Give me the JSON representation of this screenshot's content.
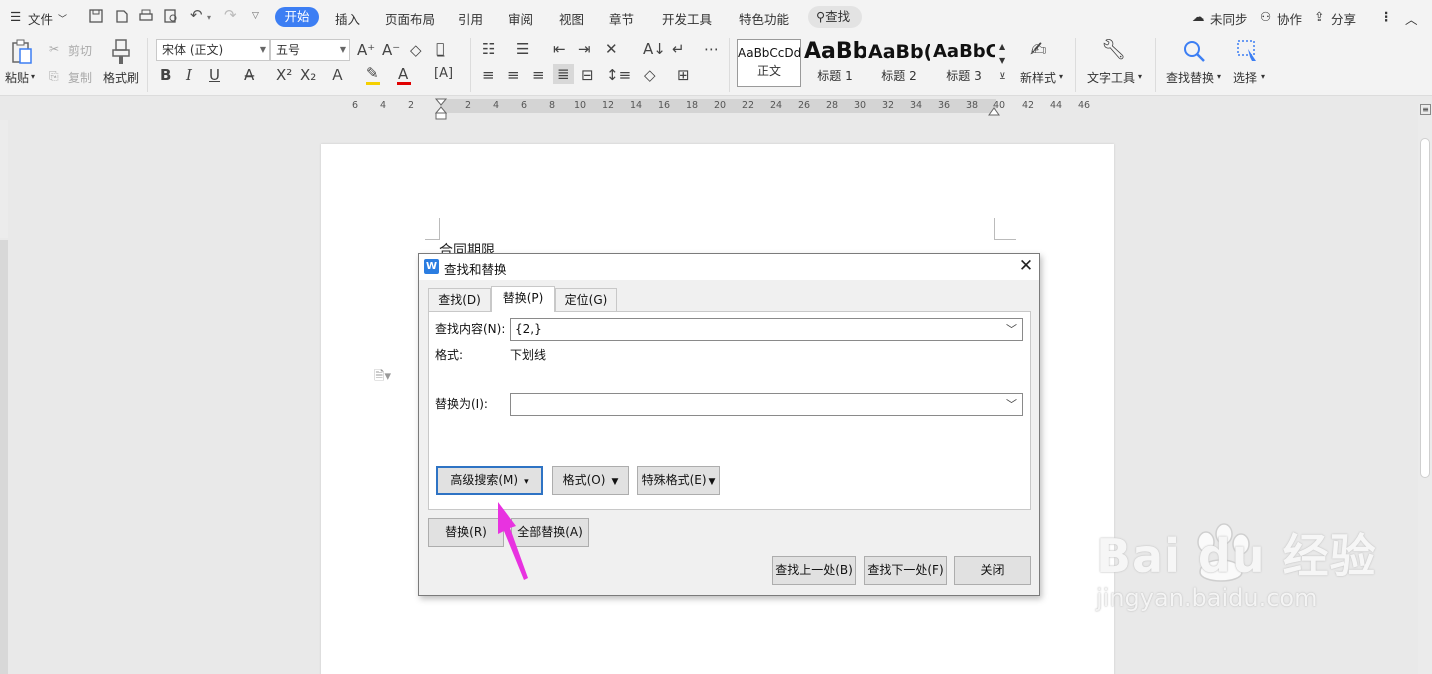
{
  "menubar": {
    "file": "文件",
    "tabs": [
      "开始",
      "插入",
      "页面布局",
      "引用",
      "审阅",
      "视图",
      "章节",
      "开发工具",
      "特色功能"
    ],
    "search": "查找",
    "sync": "未同步",
    "collab": "协作",
    "share": "分享"
  },
  "ribbon": {
    "paste": "粘贴",
    "cut": "剪切",
    "copy": "复制",
    "format_painter": "格式刷",
    "font_name": "宋体 (正文)",
    "font_size": "五号",
    "styles": [
      {
        "sample": "AaBbCcDd",
        "name": "正文"
      },
      {
        "sample": "AaBb",
        "name": "标题 1"
      },
      {
        "sample": "AaBb(",
        "name": "标题 2"
      },
      {
        "sample": "AaBbC",
        "name": "标题 3"
      }
    ],
    "new_style": "新样式",
    "text_tools": "文字工具",
    "find_replace": "查找替换",
    "select": "选择"
  },
  "ruler": {
    "ticks": [
      "6",
      "4",
      "2",
      "2",
      "4",
      "6",
      "8",
      "10",
      "12",
      "14",
      "16",
      "18",
      "20",
      "22",
      "24",
      "26",
      "28",
      "30",
      "32",
      "34",
      "36",
      "38",
      "40",
      "42",
      "44",
      "46"
    ]
  },
  "document": {
    "text": "合同期限"
  },
  "dialog": {
    "title": "查找和替换",
    "tabs": [
      "查找(D)",
      "替换(P)",
      "定位(G)"
    ],
    "active_tab": "替换(P)",
    "find_label": "查找内容(N):",
    "find_value": "{2,}",
    "format_label": "格式:",
    "format_value": "下划线",
    "replace_label": "替换为(I):",
    "replace_value": "",
    "advanced_button": "高级搜索(M)",
    "format_button": "格式(O)",
    "special_button": "特殊格式(E)",
    "replace_button": "替换(R)",
    "replace_all_button": "全部替换(A)",
    "find_prev_button": "查找上一处(B)",
    "find_next_button": "查找下一处(F)",
    "close_button": "关闭"
  },
  "watermark": {
    "main": "Bai du 经验",
    "sub": "jingyan.baidu.com"
  },
  "colors": {
    "accent": "#3c7ef3",
    "pointer": "#e832e0",
    "font_color_bar": "#e00000",
    "highlight_bar": "#f5d000"
  }
}
